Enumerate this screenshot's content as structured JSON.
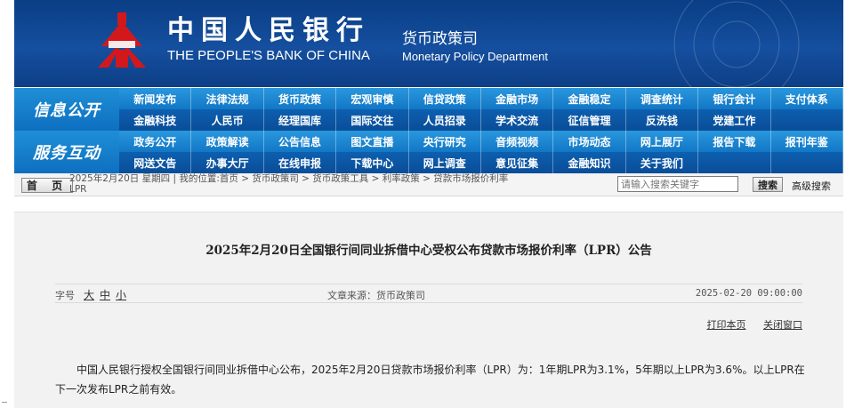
{
  "banner": {
    "bank_name_cn": "中国人民银行",
    "bank_name_en": "THE PEOPLE'S BANK OF CHINA",
    "dept_cn": "货币政策司",
    "dept_en": "Monetary Policy Department",
    "logo_icon": "pboc-logo-icon",
    "brand_color": "#0a3e85",
    "logo_color": "#d3181b"
  },
  "nav": {
    "section1": "信息公开",
    "section2": "服务互动",
    "row1": [
      "新闻发布",
      "法律法规",
      "货币政策",
      "宏观审慎",
      "信贷政策",
      "金融市场",
      "金融稳定",
      "调查统计",
      "银行会计",
      "支付体系"
    ],
    "row2": [
      "金融科技",
      "人民币",
      "经理国库",
      "国际交往",
      "人员招录",
      "学术交流",
      "征信管理",
      "反洗钱",
      "党建工作",
      ""
    ],
    "row3": [
      "政务公开",
      "政策解读",
      "公告信息",
      "图文直播",
      "央行研究",
      "音频视频",
      "市场动态",
      "网上展厅",
      "报告下载",
      "报刊年鉴"
    ],
    "row4": [
      "网送文告",
      "办事大厅",
      "在线申报",
      "下载中心",
      "网上调查",
      "意见征集",
      "金融知识",
      "关于我们",
      "",
      ""
    ]
  },
  "crumb": {
    "home": "首 页",
    "line1": "2025年2月20日 星期四 | 我的位置:首页 > 货币政策司 > 货币政策工具 > 利率政策 > 贷款市场报价利率",
    "line2": "LPR",
    "search_placeholder": "请输入搜索关键字",
    "search_button": "搜索",
    "advanced": "高级搜索"
  },
  "article": {
    "title": "2025年2月20日全国银行间同业拆借中心受权公布贷款市场报价利率（LPR）公告",
    "size_label": "字号",
    "size_large": "大",
    "size_medium": "中",
    "size_small": "小",
    "source": "文章来源：货币政策司",
    "date": "2025-02-20 09:00:00",
    "print": "打印本页",
    "close": "关闭窗口",
    "body": "中国人民银行授权全国银行间同业拆借中心公布，2025年2月20日贷款市场报价利率（LPR）为：1年期LPR为3.1%，5年期以上LPR为3.6%。以上LPR在下一次发布LPR之前有效。"
  }
}
